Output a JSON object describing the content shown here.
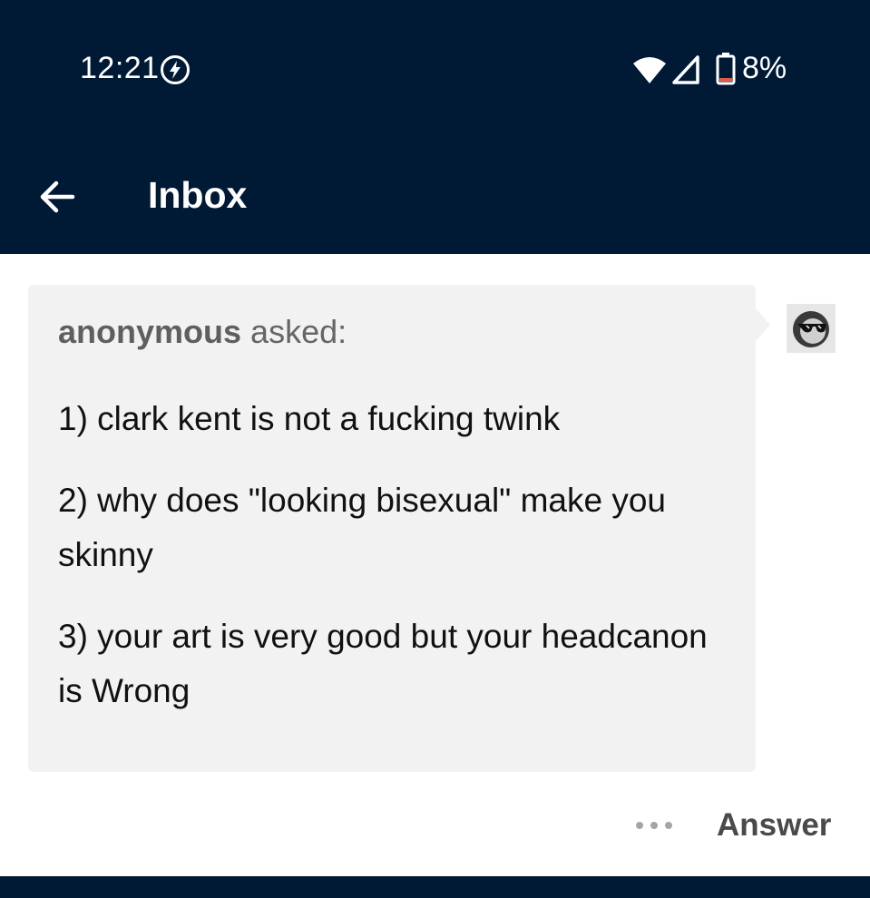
{
  "status_bar": {
    "time": "12:21",
    "battery_percent": "8%",
    "icons": [
      "flash-icon",
      "wifi-icon",
      "signal-icon",
      "battery-icon"
    ]
  },
  "header": {
    "title": "Inbox",
    "back_icon": "arrow-left-icon"
  },
  "message": {
    "asker": "anonymous",
    "asked_label": "asked:",
    "lines": [
      "1) clark kent is not a fucking twink",
      "2) why does \"looking bisexual\" make you skinny",
      "3) your art is very good but your headcanon is Wrong"
    ]
  },
  "actions": {
    "more_icon": "more-dots-icon",
    "answer_label": "Answer"
  },
  "colors": {
    "header_bg": "#001935",
    "bubble_bg": "#f2f2f2",
    "battery_low": "#e05a46"
  }
}
